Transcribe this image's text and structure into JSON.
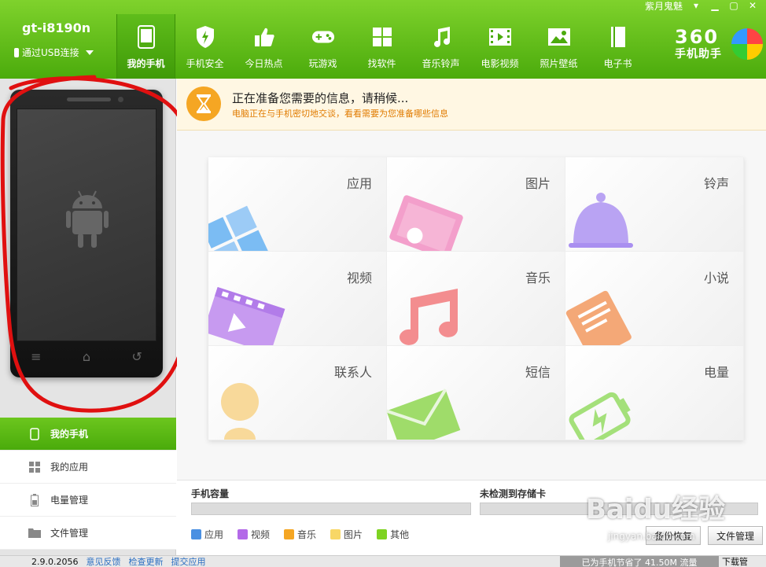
{
  "device": {
    "name": "gt-i8190n",
    "connection": "通过USB连接"
  },
  "window_controls": {
    "user": "紫月鬼魅"
  },
  "nav": [
    {
      "label": "我的手机",
      "icon": "phone-icon",
      "active": true
    },
    {
      "label": "手机安全",
      "icon": "shield-icon"
    },
    {
      "label": "今日热点",
      "icon": "thumbs-up-icon"
    },
    {
      "label": "玩游戏",
      "icon": "gamepad-icon"
    },
    {
      "label": "找软件",
      "icon": "apps-grid-icon"
    },
    {
      "label": "音乐铃声",
      "icon": "music-note-icon"
    },
    {
      "label": "电影视频",
      "icon": "film-icon"
    },
    {
      "label": "照片壁纸",
      "icon": "picture-icon"
    },
    {
      "label": "电子书",
      "icon": "book-icon"
    }
  ],
  "brand": {
    "name": "360",
    "subtitle": "手机助手"
  },
  "notice": {
    "title": "正在准备您需要的信息，请稍候...",
    "subtitle": "电脑正在与手机密切地交谈，看看需要为您准备哪些信息"
  },
  "tiles": [
    {
      "label": "应用",
      "icon": "apps-icon",
      "color": "#5aaaf0"
    },
    {
      "label": "图片",
      "icon": "picture-icon",
      "color": "#f06ab0"
    },
    {
      "label": "铃声",
      "icon": "bell-icon",
      "color": "#a77cf0"
    },
    {
      "label": "视频",
      "icon": "video-icon",
      "color": "#b36ae8"
    },
    {
      "label": "音乐",
      "icon": "music-icon",
      "color": "#f0686a"
    },
    {
      "label": "小说",
      "icon": "book-icon",
      "color": "#f08a4e"
    },
    {
      "label": "联系人",
      "icon": "contact-icon",
      "color": "#f5c45c"
    },
    {
      "label": "短信",
      "icon": "envelope-icon",
      "color": "#7fd23a"
    },
    {
      "label": "电量",
      "icon": "battery-icon",
      "color": "#7fd23a"
    }
  ],
  "left_menu": [
    {
      "label": "我的手机",
      "icon": "phone-icon",
      "active": true
    },
    {
      "label": "我的应用",
      "icon": "apps-grid-icon"
    },
    {
      "label": "电量管理",
      "icon": "battery-icon"
    },
    {
      "label": "文件管理",
      "icon": "folder-icon"
    }
  ],
  "storage": {
    "phone_label": "手机容量",
    "sd_label": "未检测到存储卡",
    "legend": [
      {
        "label": "应用",
        "color": "#4a90e2"
      },
      {
        "label": "视频",
        "color": "#b36ae8"
      },
      {
        "label": "音乐",
        "color": "#f5a623"
      },
      {
        "label": "图片",
        "color": "#f8d766"
      },
      {
        "label": "其他",
        "color": "#7ed321"
      }
    ],
    "backup_button": "备份恢复",
    "file_button": "文件管理"
  },
  "status": {
    "version": "2.9.0.2056",
    "feedback": "意见反馈",
    "update": "检查更新",
    "submit": "提交应用",
    "saved": "已为手机节省了 41.50M 流量",
    "download": "下载管"
  },
  "watermark": {
    "text": "Baidu经验",
    "url": "jingyan.baidu.com"
  },
  "colors": {
    "brand_green": "#4bab0c",
    "notice_orange": "#e07b00",
    "annotation_red": "#e01010"
  }
}
